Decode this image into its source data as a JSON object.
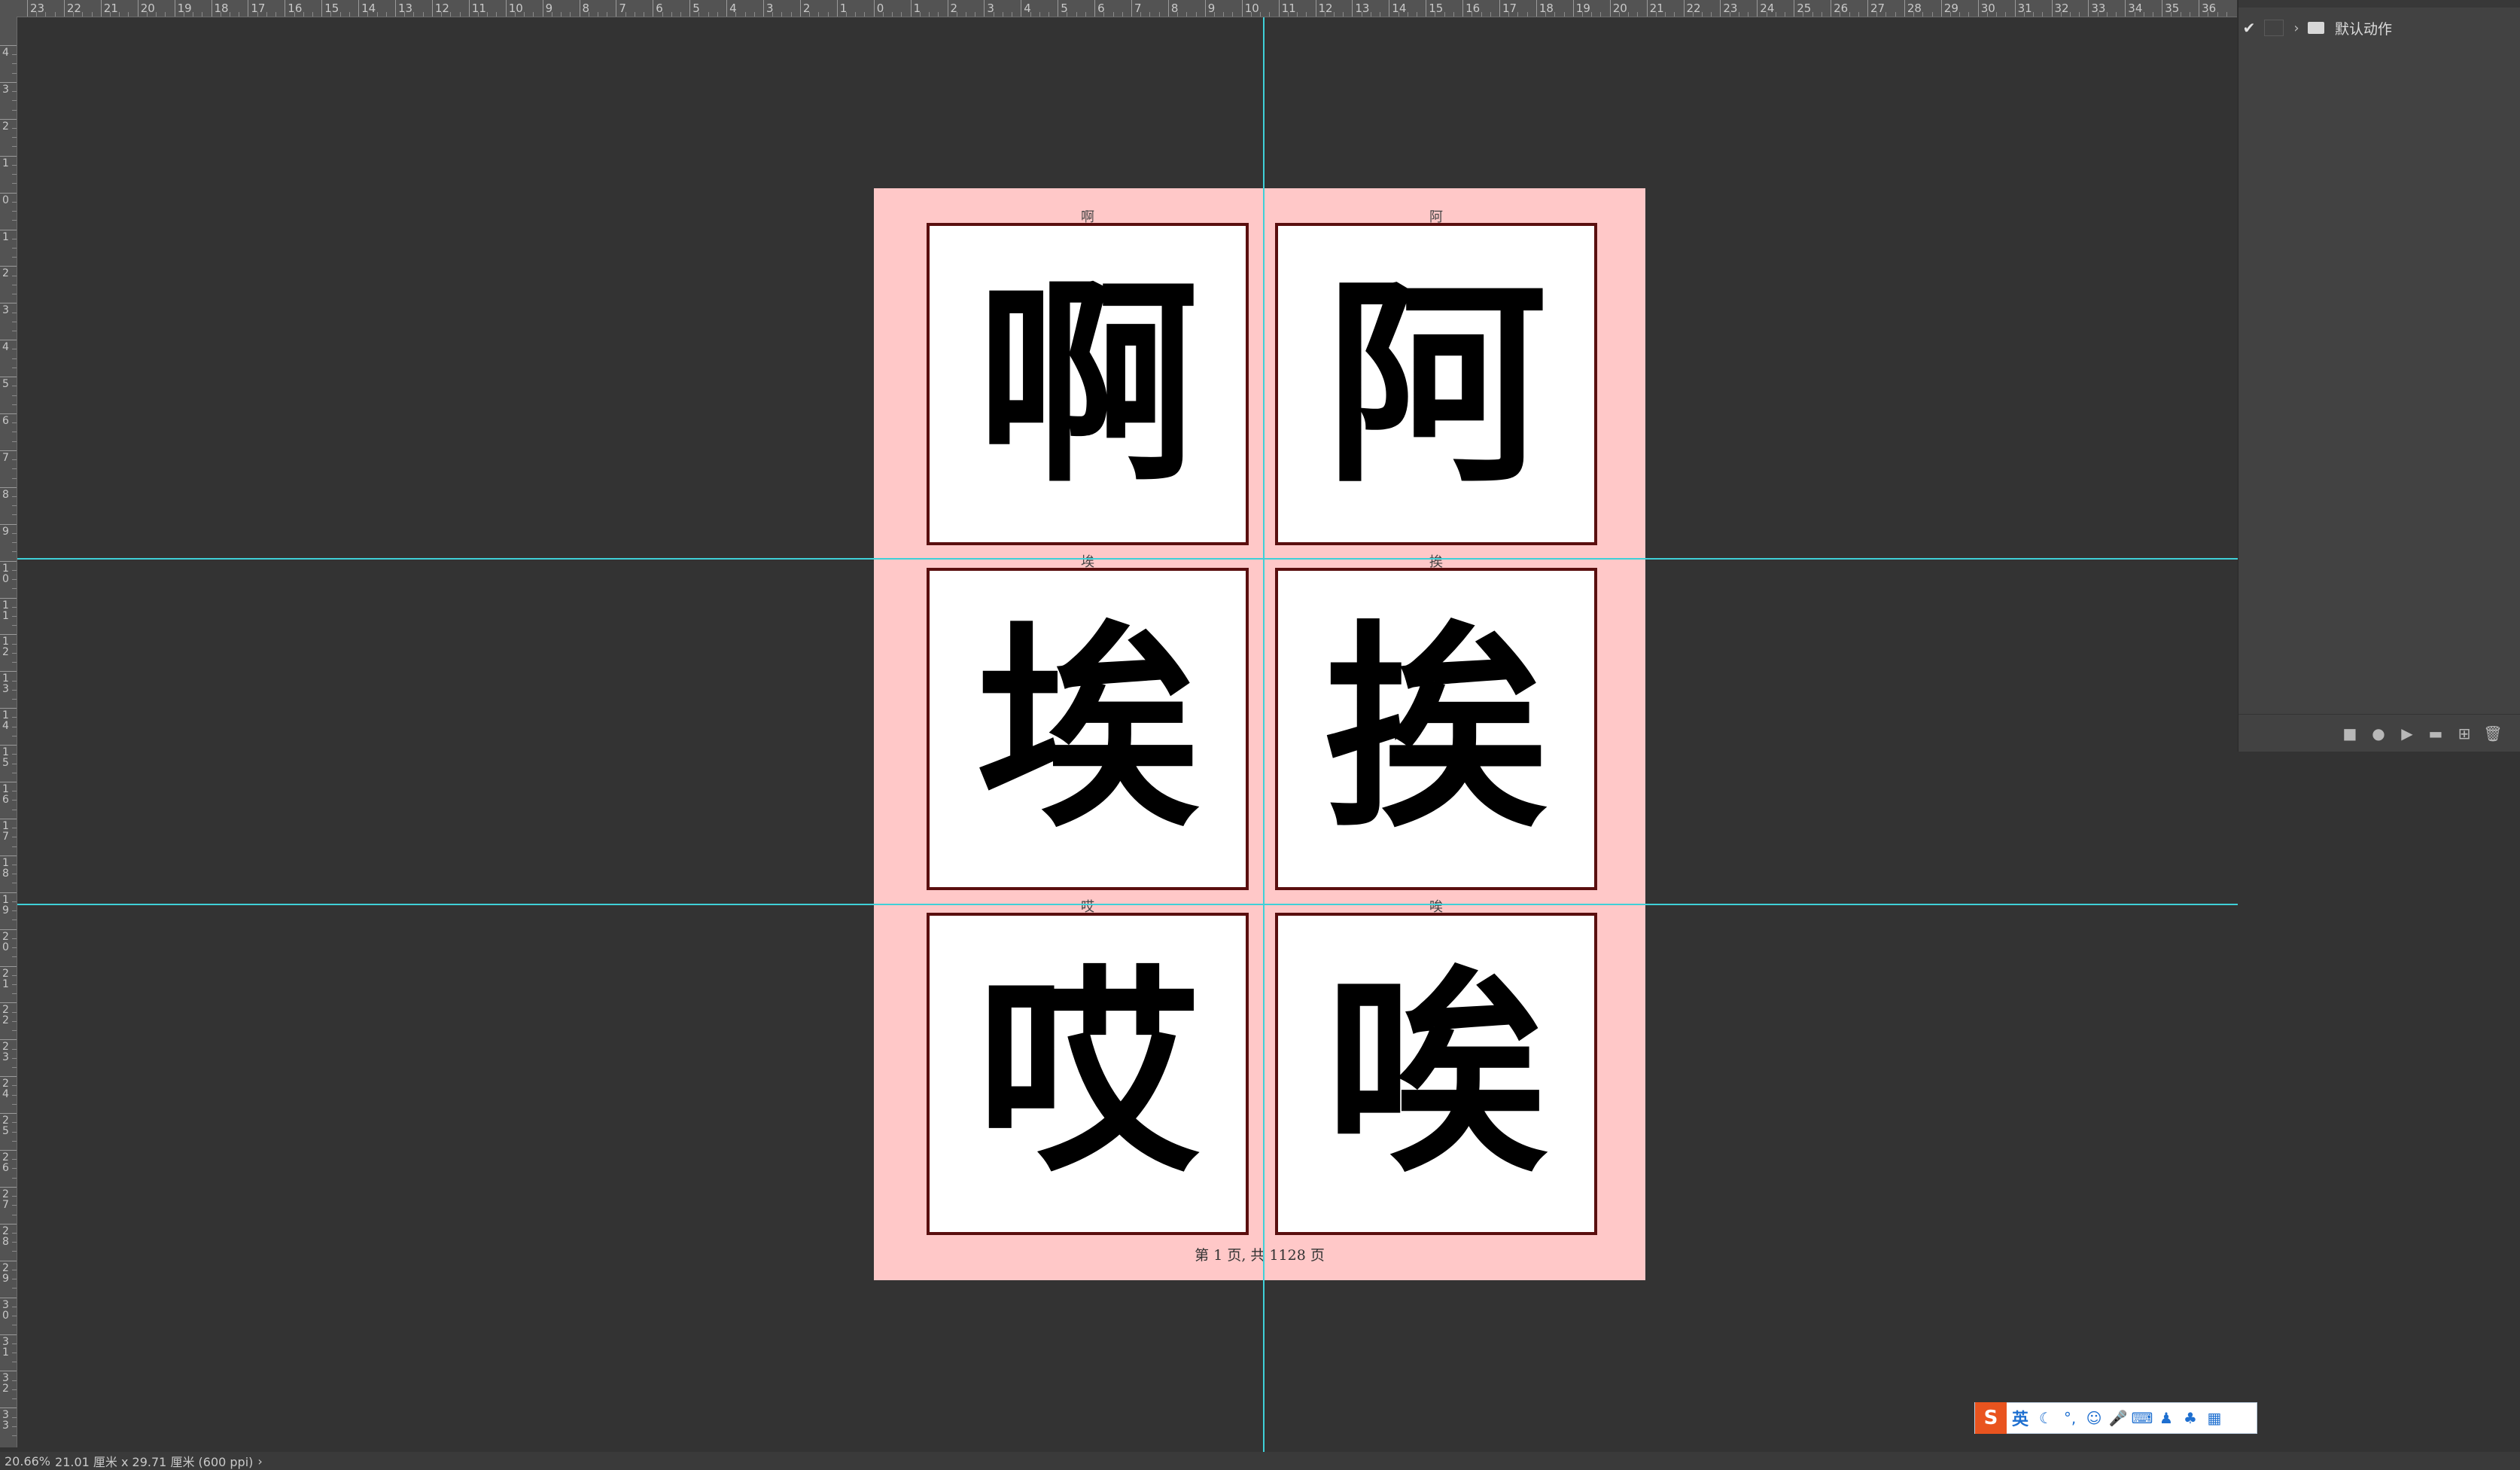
{
  "ruler": {
    "top_labels": [
      "23",
      "22",
      "21",
      "20",
      "19",
      "18",
      "17",
      "16",
      "15",
      "14",
      "13",
      "12",
      "11",
      "10",
      "9",
      "8",
      "7",
      "6",
      "5",
      "4",
      "3",
      "2",
      "1",
      "0",
      "1",
      "2",
      "3",
      "4",
      "5",
      "6",
      "7",
      "8",
      "9",
      "10",
      "11",
      "12",
      "13",
      "14",
      "15",
      "16",
      "17",
      "18",
      "19",
      "20",
      "21",
      "22",
      "23",
      "24",
      "25",
      "26",
      "27",
      "28",
      "29",
      "30",
      "31",
      "32",
      "33",
      "34",
      "35",
      "36"
    ],
    "left_labels": [
      "4",
      "3",
      "2",
      "1",
      "0",
      "1",
      "2",
      "3",
      "4",
      "5",
      "6",
      "7",
      "8",
      "9",
      "10",
      "11",
      "12",
      "13",
      "14",
      "15",
      "16",
      "17",
      "18",
      "19",
      "20",
      "21",
      "22",
      "23",
      "24",
      "25",
      "26",
      "27",
      "28",
      "29",
      "30",
      "31",
      "32",
      "33"
    ]
  },
  "document": {
    "cards": [
      {
        "label": "啊",
        "glyph": "啊"
      },
      {
        "label": "阿",
        "glyph": "阿"
      },
      {
        "label": "埃",
        "glyph": "埃"
      },
      {
        "label": "挨",
        "glyph": "挨"
      },
      {
        "label": "哎",
        "glyph": "哎"
      },
      {
        "label": "唉",
        "glyph": "唉"
      }
    ],
    "footer": "第 1 页, 共 1128 页"
  },
  "actions_panel": {
    "row_label": "默认动作",
    "check": "✔",
    "chevron": "›",
    "bottom_icons": [
      "stop-icon",
      "record-icon",
      "play-icon",
      "folder-icon",
      "new-action-icon",
      "trash-icon"
    ]
  },
  "status_bar": {
    "zoom": "20.66%",
    "doc_size": "21.01 厘米 x 29.71 厘米 (600 ppi)",
    "arrow": "›"
  },
  "ime": {
    "logo": "S",
    "lang": "英"
  },
  "colors": {
    "workspace": "#333333",
    "page_bg": "#ffc8c8",
    "card_border": "#5a0f0f",
    "guide": "#3fd0d8"
  }
}
